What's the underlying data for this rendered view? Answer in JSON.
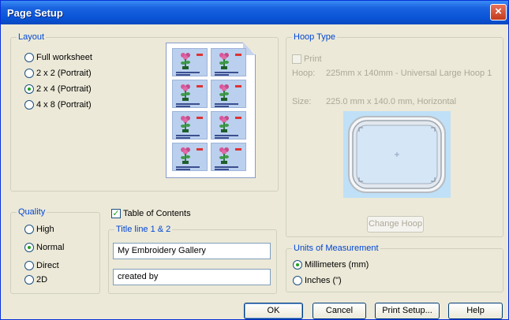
{
  "window": {
    "title": "Page Setup",
    "close_glyph": "×"
  },
  "layout": {
    "legend": "Layout",
    "options": [
      {
        "label": "Full worksheet",
        "checked": false
      },
      {
        "label": "2 x 2 (Portrait)",
        "checked": false
      },
      {
        "label": "2 x 4 (Portrait)",
        "checked": true
      },
      {
        "label": "4 x 8 (Portrait)",
        "checked": false
      }
    ]
  },
  "hoop_type": {
    "legend": "Hoop Type",
    "print_label": "Print",
    "hoop_label": "Hoop:",
    "hoop_value": "225mm x 140mm - Universal Large Hoop 1",
    "size_label": "Size:",
    "size_value": "225.0 mm x 140.0 mm, Horizontal",
    "change_hoop_label": "Change Hoop"
  },
  "quality": {
    "legend": "Quality",
    "options": [
      {
        "label": "High",
        "checked": false
      },
      {
        "label": "Normal",
        "checked": true
      },
      {
        "label": "Direct",
        "checked": false
      },
      {
        "label": "2D",
        "checked": false
      }
    ]
  },
  "toc": {
    "label": "Table of Contents",
    "checked": true,
    "check_glyph": "✓"
  },
  "title_lines": {
    "legend": "Title line 1 & 2",
    "line1": "My Embroidery Gallery",
    "line2": "created by"
  },
  "units": {
    "legend": "Units of Measurement",
    "options": [
      {
        "label": "Millimeters (mm)",
        "checked": true
      },
      {
        "label": "Inches (\")",
        "checked": false
      }
    ]
  },
  "buttons": {
    "ok": "OK",
    "cancel": "Cancel",
    "print_setup": "Print Setup...",
    "help": "Help"
  },
  "colors": {
    "accent": "#0046d5",
    "title_bar": "#0a55d8",
    "window_bg": "#ece9d8"
  }
}
